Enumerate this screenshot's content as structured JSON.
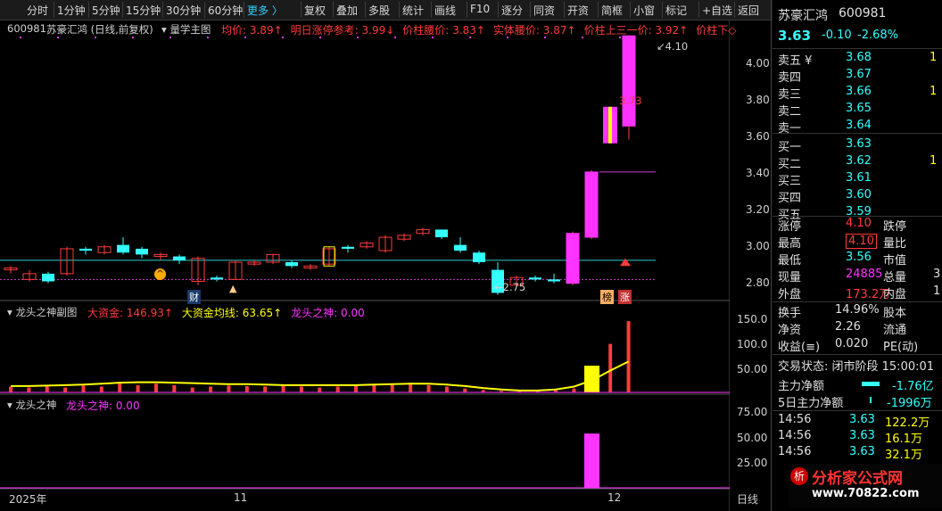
{
  "toolbar": {
    "items": [
      "分时",
      "1分钟",
      "5分钟",
      "15分钟",
      "30分钟",
      "60分钟",
      "更多 〉",
      "复权",
      "叠加",
      "多股",
      "统计",
      "画线",
      "F10",
      "逐分",
      "同资",
      "开资",
      "简框",
      "小窗",
      "标记",
      "+自选",
      "返回"
    ]
  },
  "main": {
    "code": "600981",
    "title": "苏豪汇鸿 (日线,前复权)",
    "formula": "量学主图",
    "ind": [
      {
        "t": "均价: 3.89↑",
        "c": "#ff3b3b"
      },
      {
        "t": "明日涨停参考: 3.99↓",
        "c": "#ff3b3b"
      },
      {
        "t": "价柱腰价: 3.83↑",
        "c": "#ff3b3b"
      },
      {
        "t": "实体腰价: 3.87↑",
        "c": "#ff3b3b"
      },
      {
        "t": "价柱上三一价: 3.92↑",
        "c": "#ff3b3b"
      },
      {
        "t": "价柱下◇",
        "c": "#ff3b3b"
      }
    ],
    "yticks": [
      "4.00",
      "3.80",
      "3.60",
      "3.40",
      "3.20",
      "3.00",
      "2.80"
    ],
    "hi_label": "4.10",
    "lo_label": "2.75",
    "mark_label": "3.73",
    "badges": [
      "财",
      "榜",
      "涨"
    ]
  },
  "sub1": {
    "title": "龙头之神副图",
    "ind": [
      {
        "t": "大资金: 146.93↑",
        "c": "#ff3b3b"
      },
      {
        "t": "大资金均线: 63.65↑",
        "c": "#ffff00"
      },
      {
        "t": "龙头之神: 0.00",
        "c": "#ff33ff"
      }
    ],
    "yticks": [
      "150.0",
      "100.0",
      "50.00"
    ]
  },
  "sub2": {
    "title": "龙头之神",
    "ind": [
      {
        "t": "龙头之神: 0.00",
        "c": "#ff33ff"
      }
    ],
    "yticks": [
      "75.00",
      "50.00",
      "25.00"
    ]
  },
  "xaxis": [
    "2025年",
    "11",
    "12",
    "日线"
  ],
  "chart_data": {
    "type": "candlestick",
    "ylim": [
      2.72,
      4.18
    ],
    "candles": [
      [
        2.88,
        2.89,
        2.86,
        2.9
      ],
      [
        2.83,
        2.86,
        2.82,
        2.88
      ],
      [
        2.86,
        2.82,
        2.81,
        2.87
      ],
      [
        2.86,
        2.99,
        2.85,
        3.0
      ],
      [
        2.99,
        2.98,
        2.96,
        3.0
      ],
      [
        2.97,
        3.0,
        2.96,
        3.01
      ],
      [
        3.01,
        2.97,
        2.96,
        3.05
      ],
      [
        2.99,
        2.96,
        2.94,
        3.0
      ],
      [
        2.95,
        2.96,
        2.93,
        2.97
      ],
      [
        2.95,
        2.93,
        2.91,
        2.96
      ],
      [
        2.82,
        2.94,
        2.8,
        2.95
      ],
      [
        2.84,
        2.83,
        2.82,
        2.85
      ],
      [
        2.83,
        2.92,
        2.83,
        2.93
      ],
      [
        2.91,
        2.92,
        2.9,
        2.93
      ],
      [
        2.92,
        2.96,
        2.91,
        2.96
      ],
      [
        2.92,
        2.9,
        2.89,
        2.93
      ],
      [
        2.89,
        2.9,
        2.88,
        2.91
      ],
      [
        2.91,
        2.99,
        2.9,
        3.0
      ],
      [
        3.0,
        2.99,
        2.97,
        3.01
      ],
      [
        3.0,
        3.02,
        2.99,
        3.03
      ],
      [
        2.98,
        3.05,
        2.97,
        3.06
      ],
      [
        3.04,
        3.06,
        3.03,
        3.07
      ],
      [
        3.07,
        3.09,
        3.06,
        3.1
      ],
      [
        3.09,
        3.05,
        3.04,
        3.09
      ],
      [
        3.01,
        2.98,
        2.97,
        3.05
      ],
      [
        2.97,
        2.92,
        2.91,
        2.98
      ],
      [
        2.88,
        2.76,
        2.75,
        2.92
      ],
      [
        2.8,
        2.84,
        2.79,
        2.85
      ],
      [
        2.84,
        2.83,
        2.82,
        2.85
      ],
      [
        2.83,
        2.82,
        2.81,
        2.86
      ],
      [
        2.81,
        3.07,
        2.8,
        3.08
      ],
      [
        3.05,
        3.39,
        3.04,
        3.4
      ],
      [
        3.54,
        3.73,
        3.54,
        3.73
      ],
      [
        3.63,
        4.1,
        3.56,
        4.1
      ]
    ],
    "ma_avg": 2.93,
    "ma_purple": 2.83,
    "ma_top": 3.39,
    "big_money": [
      12,
      10,
      15,
      10,
      14,
      12,
      20,
      15,
      18,
      15,
      10,
      12,
      14,
      13,
      12,
      14,
      12,
      10,
      12,
      14,
      16,
      18,
      20,
      15,
      12,
      8,
      5,
      3,
      2,
      2,
      4,
      8,
      30,
      100,
      146.93
    ],
    "big_money_ma": [
      13,
      13,
      14,
      15,
      16,
      18,
      20,
      21,
      21,
      20,
      19,
      18,
      17,
      17,
      16,
      15,
      15,
      15,
      15,
      15,
      16,
      17,
      18,
      18,
      16,
      13,
      9,
      6,
      4,
      4,
      6,
      12,
      25,
      45,
      63.65
    ],
    "dragon": [
      0,
      0,
      0,
      0,
      0,
      0,
      0,
      0,
      0,
      0,
      0,
      0,
      0,
      0,
      0,
      0,
      0,
      0,
      0,
      0,
      0,
      0,
      0,
      0,
      0,
      0,
      0,
      0,
      0,
      0,
      0,
      58,
      0,
      0
    ],
    "yellow_bar": 55
  },
  "panel": {
    "name": "苏豪汇鸿",
    "code": "600981",
    "price": "3.63",
    "chg": "-0.10",
    "pct": "-2.68%",
    "asks": [
      {
        "l": "卖五 ¥",
        "p": "3.68",
        "v": "1"
      },
      {
        "l": "卖四",
        "p": "3.67",
        "v": ""
      },
      {
        "l": "卖三",
        "p": "3.66",
        "v": "1"
      },
      {
        "l": "卖二",
        "p": "3.65",
        "v": ""
      },
      {
        "l": "卖一",
        "p": "3.64",
        "v": ""
      }
    ],
    "bids": [
      {
        "l": "买一",
        "p": "3.63",
        "v": ""
      },
      {
        "l": "买二",
        "p": "3.62",
        "v": "1"
      },
      {
        "l": "买三",
        "p": "3.61",
        "v": ""
      },
      {
        "l": "买四",
        "p": "3.60",
        "v": ""
      },
      {
        "l": "买五",
        "p": "3.59",
        "v": ""
      }
    ],
    "stats": [
      {
        "l": "涨停",
        "v": "4.10",
        "c": "#ff3b3b",
        "l2": "跌停"
      },
      {
        "l": "最高",
        "v": "4.10",
        "c": "#ff3b3b",
        "l2": "量比"
      },
      {
        "l": "最低",
        "v": "3.56",
        "c": "#33ffff",
        "l2": "市值"
      },
      {
        "l": "现量",
        "v": "24885",
        "c": "#ff33ff",
        "l2": "总量",
        "v2": "3"
      },
      {
        "l": "外盘",
        "v": "173.2万",
        "c": "#ff3b3b",
        "l2": "内盘",
        "v2": "1"
      }
    ],
    "stats2": [
      {
        "l": "换手",
        "v": "14.96%",
        "l2": "股本"
      },
      {
        "l": "净资",
        "v": "2.26",
        "l2": "流通"
      },
      {
        "l": "收益(≡)",
        "v": "0.020",
        "l2": "PE(动)"
      }
    ],
    "trade_state": "交易状态: 闭市阶段 15:00:01",
    "main_flow": {
      "l": "主力净额",
      "v": "-1.76亿"
    },
    "main_flow5": {
      "l": "5日主力净额",
      "v": "-1996万"
    },
    "ticks": [
      {
        "t": "14:56",
        "p": "3.63",
        "v": "122.2万"
      },
      {
        "t": "14:56",
        "p": "3.63",
        "v": "16.1万"
      },
      {
        "t": "14:56",
        "p": "3.63",
        "v": "32.1万"
      }
    ],
    "watermark": "分析家公式网",
    "watermark_url": "www.70822.com"
  }
}
